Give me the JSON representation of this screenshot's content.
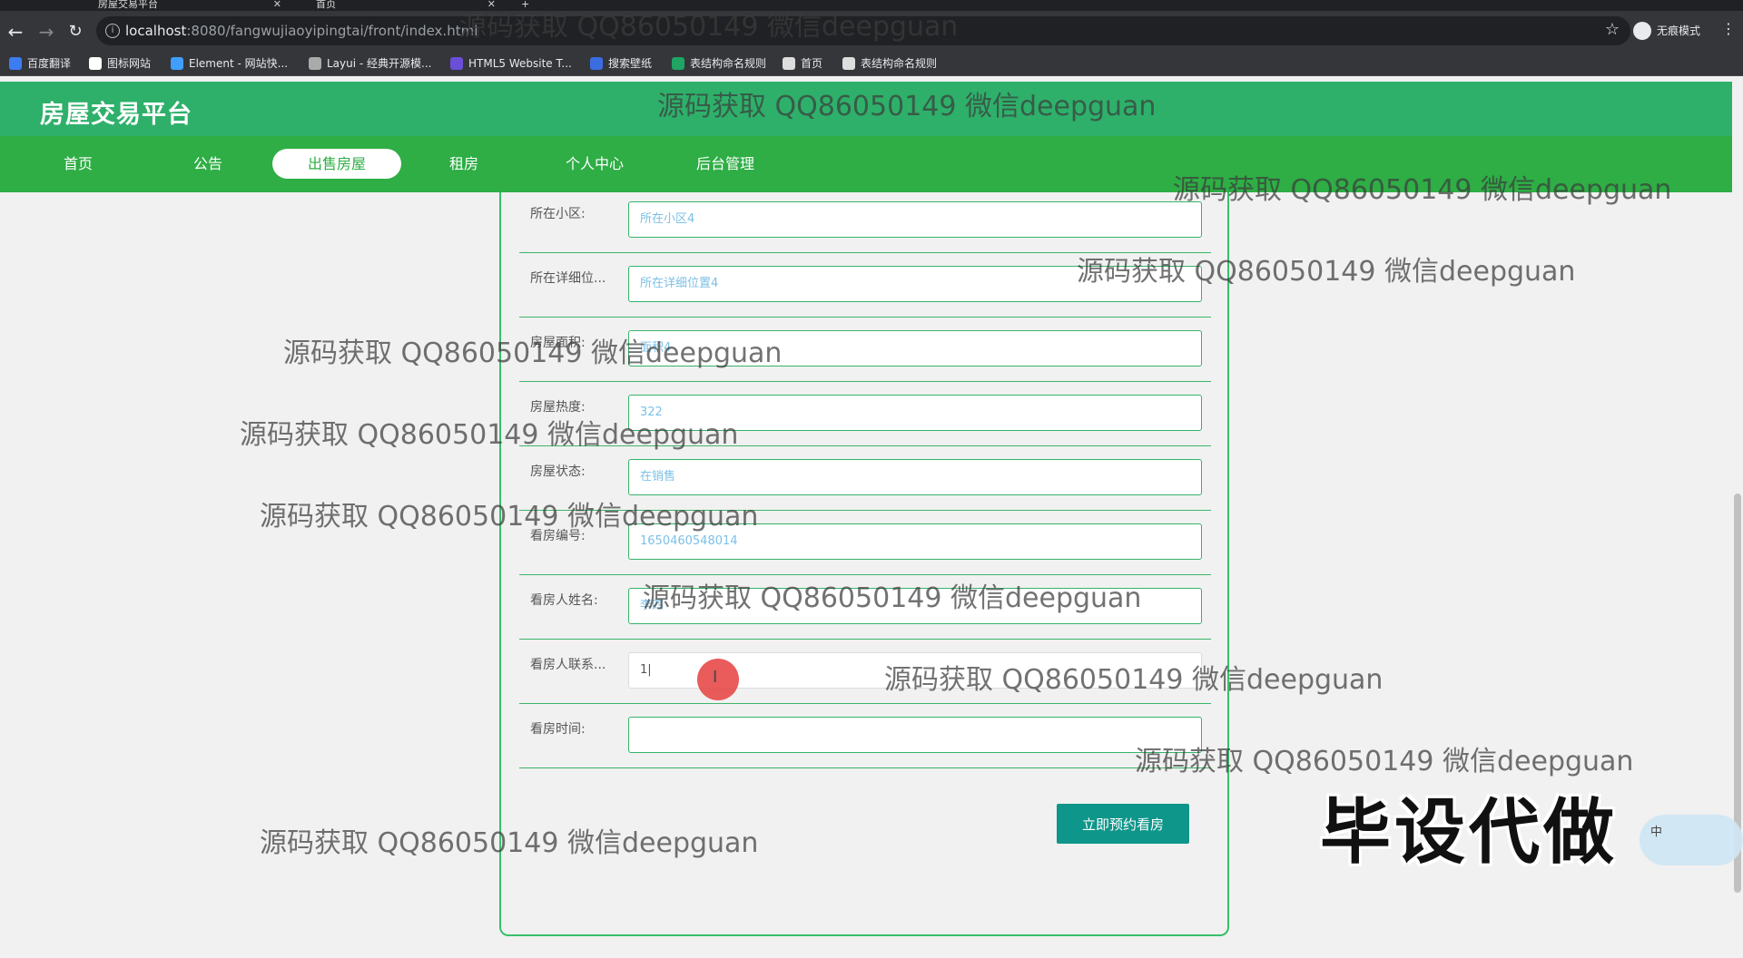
{
  "browser": {
    "tabs": [
      {
        "title": "房屋交易平台"
      },
      {
        "title": "首页"
      }
    ],
    "url_host": "localhost",
    "url_path": ":8080/fangwujiaoyipingtai/front/index.html",
    "profile_label": "无痕模式",
    "bookmarks": [
      {
        "label": "百度翻译",
        "color": "#3d7cf1"
      },
      {
        "label": "图标网站",
        "color": "#ffffff"
      },
      {
        "label": "Element - 网站快...",
        "color": "#409eff"
      },
      {
        "label": "Layui - 经典开源模...",
        "color": "#aaaaaa"
      },
      {
        "label": "HTML5 Website T...",
        "color": "#6b4fd8"
      },
      {
        "label": "搜索壁纸",
        "color": "#3b6de0"
      },
      {
        "label": "表结构命名规则",
        "color": "#1fa463"
      },
      {
        "label": "首页",
        "color": "#dddddd"
      },
      {
        "label": "表结构命名规则",
        "color": "#dddddd"
      }
    ]
  },
  "site": {
    "logo": "房屋交易平台",
    "nav": [
      {
        "label": "首页",
        "active": false
      },
      {
        "label": "公告",
        "active": false
      },
      {
        "label": "出售房屋",
        "active": true
      },
      {
        "label": "租房",
        "active": false
      },
      {
        "label": "个人中心",
        "active": false
      },
      {
        "label": "后台管理",
        "active": false
      }
    ],
    "accent": "#2eae45"
  },
  "form": {
    "fields": [
      {
        "label": "所在小区:",
        "value": "所在小区4"
      },
      {
        "label": "所在详细位...",
        "value": "所在详细位置4"
      },
      {
        "label": "房屋面积:",
        "value": "面积4"
      },
      {
        "label": "房屋热度:",
        "value": "322"
      },
      {
        "label": "房屋状态:",
        "value": "在销售"
      },
      {
        "label": "看房编号:",
        "value": "1650460548014"
      },
      {
        "label": "看房人姓名:",
        "value": "李四"
      },
      {
        "label": "看房人联系...",
        "value": "1|"
      },
      {
        "label": "看房时间:",
        "value": ""
      }
    ],
    "submit_label": "立即预约看房"
  },
  "overlays": {
    "watermark": "源码获取 QQ86050149 微信deepguan",
    "big_text": "毕设代做",
    "ime_label": "中"
  }
}
